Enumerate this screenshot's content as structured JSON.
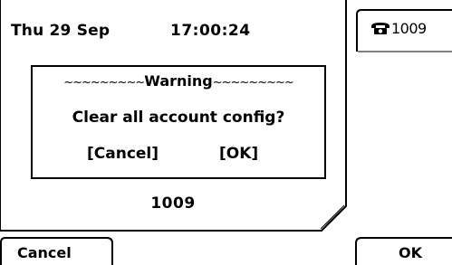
{
  "status_bar": {
    "date": "Thu 29 Sep",
    "time": "17:00:24"
  },
  "dialog": {
    "title": "Warning",
    "message": "Clear all account config?",
    "cancel_label": "[Cancel]",
    "ok_label": "[OK]"
  },
  "account_label": "1009",
  "line_key": {
    "icon": "phone-icon",
    "label": "1009"
  },
  "softkeys": {
    "left_label": "Cancel",
    "right_label": "OK"
  }
}
